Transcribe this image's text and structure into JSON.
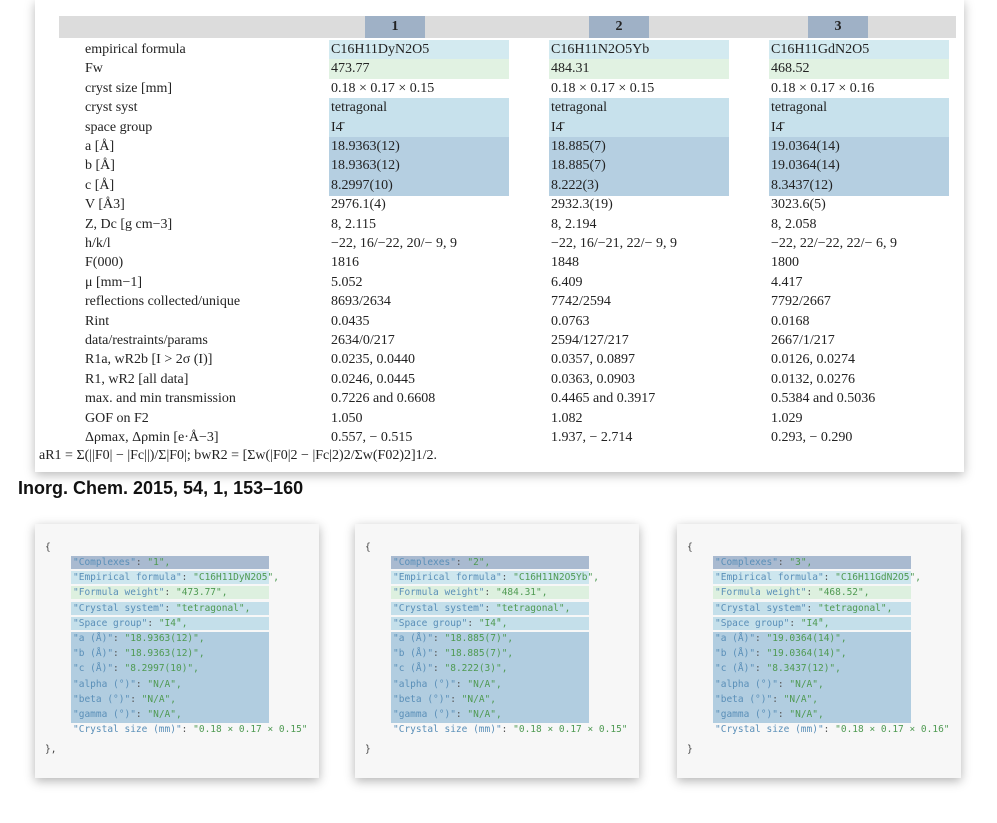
{
  "table": {
    "compounds": [
      "1",
      "2",
      "3"
    ],
    "rows": [
      {
        "label": "empirical formula",
        "values": [
          "C16H11DyN2O5",
          "C16H11N2O5Yb",
          "C16H11GdN2O5"
        ]
      },
      {
        "label": "Fw",
        "values": [
          "473.77",
          "484.31",
          "468.52"
        ]
      },
      {
        "label": "cryst size [mm]",
        "values": [
          "0.18 × 0.17 × 0.15",
          "0.18 × 0.17 × 0.15",
          "0.18 × 0.17 × 0.16"
        ]
      },
      {
        "label": "cryst syst",
        "values": [
          "tetragonal",
          "tetragonal",
          "tetragonal"
        ]
      },
      {
        "label": "space group",
        "values": [
          "I4̄",
          "I4̄",
          "I4̄"
        ]
      },
      {
        "label": "a [Å]",
        "values": [
          "18.9363(12)",
          "18.885(7)",
          "19.0364(14)"
        ]
      },
      {
        "label": "b [Å]",
        "values": [
          "18.9363(12)",
          "18.885(7)",
          "19.0364(14)"
        ]
      },
      {
        "label": "c [Å]",
        "values": [
          "8.2997(10)",
          "8.222(3)",
          "8.3437(12)"
        ]
      },
      {
        "label": "V [Å3]",
        "values": [
          "2976.1(4)",
          "2932.3(19)",
          "3023.6(5)"
        ]
      },
      {
        "label": "Z, Dc [g cm−3]",
        "values": [
          "8, 2.115",
          "8, 2.194",
          "8, 2.058"
        ]
      },
      {
        "label": "h/k/l",
        "values": [
          "−22, 16/−22, 20/− 9, 9",
          "−22, 16/−21, 22/− 9, 9",
          "−22, 22/−22, 22/− 6, 9"
        ]
      },
      {
        "label": "F(000)",
        "values": [
          "1816",
          "1848",
          "1800"
        ]
      },
      {
        "label": "μ [mm−1]",
        "values": [
          "5.052",
          "6.409",
          "4.417"
        ]
      },
      {
        "label": "reflections collected/unique",
        "values": [
          "8693/2634",
          "7742/2594",
          "7792/2667"
        ]
      },
      {
        "label": "Rint",
        "values": [
          "0.0435",
          "0.0763",
          "0.0168"
        ]
      },
      {
        "label": "data/restraints/params",
        "values": [
          "2634/0/217",
          "2594/127/217",
          "2667/1/217"
        ]
      },
      {
        "label": "R1a, wR2b [I > 2σ (I)]",
        "values": [
          "0.0235, 0.0440",
          "0.0357, 0.0897",
          "0.0126, 0.0274"
        ]
      },
      {
        "label": "R1, wR2 [all data]",
        "values": [
          "0.0246, 0.0445",
          "0.0363, 0.0903",
          "0.0132, 0.0276"
        ]
      },
      {
        "label": "max. and min transmission",
        "values": [
          "0.7226 and 0.6608",
          "0.4465 and 0.3917",
          "0.5384 and 0.5036"
        ]
      },
      {
        "label": "GOF on F2",
        "values": [
          "1.050",
          "1.082",
          "1.029"
        ]
      },
      {
        "label": "Δρmax, Δρmin [e·Å−3]",
        "values": [
          "0.557, − 0.515",
          "1.937, − 2.714",
          "0.293, − 0.290"
        ]
      }
    ],
    "footnote": "aR1 = Σ(||F0| − |Fc||)/Σ|F0|; bwR2 = [Σw(|F0|2 − |Fc|2)2/Σw(F02)2]1/2."
  },
  "citation": "Inorg. Chem. 2015, 54, 1, 153–160",
  "json_cards": [
    {
      "open": "{",
      "close": "},",
      "entries": [
        {
          "key": "\"Complexes\"",
          "value": "\"1\","
        },
        {
          "key": "\"Empirical formula\"",
          "value": "\"C16H11DyN2O5\","
        },
        {
          "key": "\"Formula weight\"",
          "value": "\"473.77\","
        },
        {
          "key": "\"Crystal system\"",
          "value": "\"tetragonal\","
        },
        {
          "key": "\"Space group\"",
          "value": "\"I4̄\","
        },
        {
          "key": "\"a (Å)\"",
          "value": "\"18.9363(12)\","
        },
        {
          "key": "\"b (Å)\"",
          "value": "\"18.9363(12)\","
        },
        {
          "key": "\"c (Å)\"",
          "value": "\"8.2997(10)\","
        },
        {
          "key": "\"alpha (°)\"",
          "value": "\"N/A\","
        },
        {
          "key": "\"beta (°)\"",
          "value": "\"N/A\","
        },
        {
          "key": "\"gamma (°)\"",
          "value": "\"N/A\","
        },
        {
          "key": "\"Crystal size (mm)\"",
          "value": "\"0.18 × 0.17 × 0.15\""
        }
      ]
    },
    {
      "open": "{",
      "close": "}",
      "entries": [
        {
          "key": "\"Complexes\"",
          "value": "\"2\","
        },
        {
          "key": "\"Empirical formula\"",
          "value": "\"C16H11N2O5Yb\","
        },
        {
          "key": "\"Formula weight\"",
          "value": "\"484.31\","
        },
        {
          "key": "\"Crystal system\"",
          "value": "\"tetragonal\","
        },
        {
          "key": "\"Space group\"",
          "value": "\"I4̄\","
        },
        {
          "key": "\"a (Å)\"",
          "value": "\"18.885(7)\","
        },
        {
          "key": "\"b (Å)\"",
          "value": "\"18.885(7)\","
        },
        {
          "key": "\"c (Å)\"",
          "value": "\"8.222(3)\","
        },
        {
          "key": "\"alpha (°)\"",
          "value": "\"N/A\","
        },
        {
          "key": "\"beta (°)\"",
          "value": "\"N/A\","
        },
        {
          "key": "\"gamma (°)\"",
          "value": "\"N/A\","
        },
        {
          "key": "\"Crystal size (mm)\"",
          "value": "\"0.18 × 0.17 × 0.15\""
        }
      ]
    },
    {
      "open": "{",
      "close": "}",
      "entries": [
        {
          "key": "\"Complexes\"",
          "value": "\"3\","
        },
        {
          "key": "\"Empirical formula\"",
          "value": "\"C16H11GdN2O5\","
        },
        {
          "key": "\"Formula weight\"",
          "value": "\"468.52\","
        },
        {
          "key": "\"Crystal system\"",
          "value": "\"tetragonal\","
        },
        {
          "key": "\"Space group\"",
          "value": "\"I4̄\","
        },
        {
          "key": "\"a (Å)\"",
          "value": "\"19.0364(14)\","
        },
        {
          "key": "\"b (Å)\"",
          "value": "\"19.0364(14)\","
        },
        {
          "key": "\"c (Å)\"",
          "value": "\"8.3437(12)\","
        },
        {
          "key": "\"alpha (°)\"",
          "value": "\"N/A\","
        },
        {
          "key": "\"beta (°)\"",
          "value": "\"N/A\","
        },
        {
          "key": "\"gamma (°)\"",
          "value": "\"N/A\","
        },
        {
          "key": "\"Crystal size (mm)\"",
          "value": "\"0.18 × 0.17 × 0.16\""
        }
      ]
    }
  ]
}
